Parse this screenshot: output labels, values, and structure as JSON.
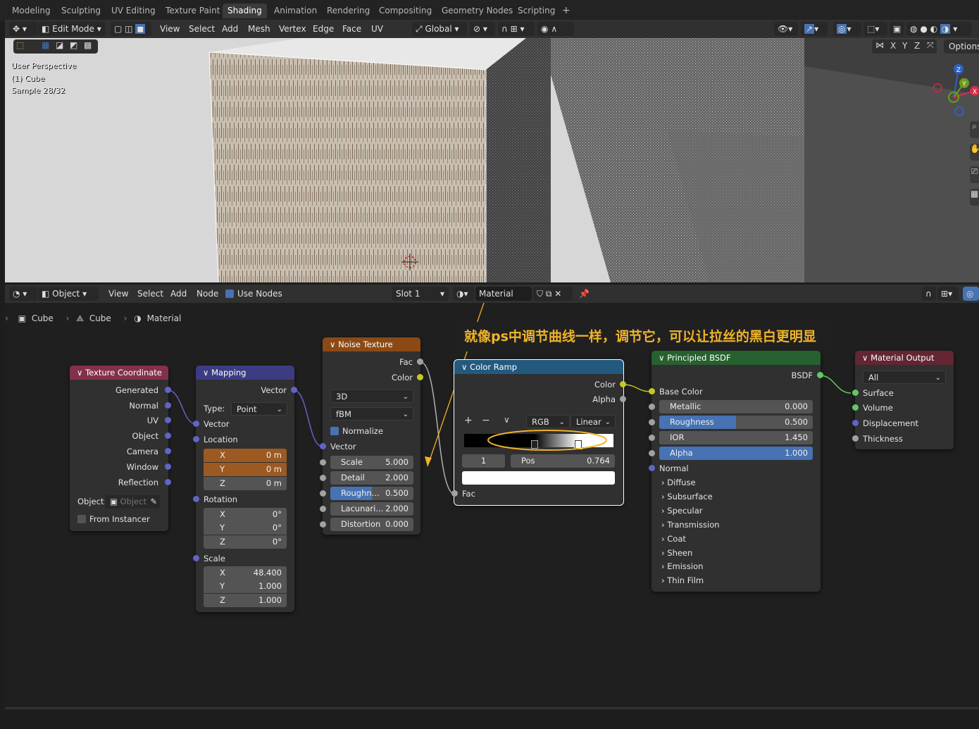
{
  "workspace_tabs": [
    "Modeling",
    "Sculpting",
    "UV Editing",
    "Texture Paint",
    "Shading",
    "Animation",
    "Rendering",
    "Compositing",
    "Geometry Nodes",
    "Scripting",
    "+"
  ],
  "viewport_header": {
    "mode": "Edit Mode",
    "menus": [
      "View",
      "Select",
      "Add",
      "Mesh",
      "Vertex",
      "Edge",
      "Face",
      "UV"
    ],
    "orientation": "Global",
    "options": "Options",
    "axes": [
      "X",
      "Y",
      "Z"
    ]
  },
  "viewport": {
    "overlay": [
      "User Perspective",
      "(1) Cube",
      "Sample 28/32"
    ],
    "gizmo": {
      "z": "Z",
      "y": "Y",
      "x": "X"
    }
  },
  "node_header": {
    "object_mode": "Object",
    "menus": [
      "View",
      "Select",
      "Add",
      "Node"
    ],
    "use_nodes": "Use Nodes",
    "slot": "Slot 1",
    "material": "Material"
  },
  "breadcrumb": [
    "Cube",
    "Cube",
    "Material"
  ],
  "annotation": "就像ps中调节曲线一样，调节它，可以让拉丝的黑白更明显",
  "nodes": {
    "texture_coordinate": {
      "title": "Texture Coordinate",
      "outputs": [
        "Generated",
        "Normal",
        "UV",
        "Object",
        "Camera",
        "Window",
        "Reflection"
      ],
      "object_label": "Object:",
      "object_placeholder": "Object",
      "from_instancer": "From Instancer"
    },
    "mapping": {
      "title": "Mapping",
      "output": "Vector",
      "type_label": "Type:",
      "type_value": "Point",
      "vector": "Vector",
      "location": "Location",
      "loc": [
        {
          "a": "X",
          "v": "0 m"
        },
        {
          "a": "Y",
          "v": "0 m"
        },
        {
          "a": "Z",
          "v": "0 m"
        }
      ],
      "rotation": "Rotation",
      "rot": [
        {
          "a": "X",
          "v": "0°"
        },
        {
          "a": "Y",
          "v": "0°"
        },
        {
          "a": "Z",
          "v": "0°"
        }
      ],
      "scale": "Scale",
      "scl": [
        {
          "a": "X",
          "v": "48.400"
        },
        {
          "a": "Y",
          "v": "1.000"
        },
        {
          "a": "Z",
          "v": "1.000"
        }
      ]
    },
    "noise": {
      "title": "Noise Texture",
      "outputs": [
        "Fac",
        "Color"
      ],
      "dim": "3D",
      "type": "fBM",
      "normalize": "Normalize",
      "vector": "Vector",
      "fields": [
        {
          "l": "Scale",
          "v": "5.000"
        },
        {
          "l": "Detail",
          "v": "2.000"
        },
        {
          "l": "Roughn...",
          "v": "0.500",
          "fill": 0.5
        },
        {
          "l": "Lacunari...",
          "v": "2.000"
        },
        {
          "l": "Distortion",
          "v": "0.000"
        }
      ]
    },
    "color_ramp": {
      "title": "Color Ramp",
      "outputs": [
        "Color",
        "Alpha"
      ],
      "mode": "RGB",
      "interp": "Linear",
      "plus": "+",
      "minus": "−",
      "index": "1",
      "pos_label": "Pos",
      "pos_value": "0.764",
      "input": "Fac",
      "stops": [
        0.47,
        0.764
      ]
    },
    "principled": {
      "title": "Principled BSDF",
      "output": "BSDF",
      "base_color": "Base Color",
      "fields": [
        {
          "l": "Metallic",
          "v": "0.000",
          "fill": 0
        },
        {
          "l": "Roughness",
          "v": "0.500",
          "fill": 0.5
        },
        {
          "l": "IOR",
          "v": "1.450",
          "fill": 0
        },
        {
          "l": "Alpha",
          "v": "1.000",
          "fill": 1
        }
      ],
      "normal": "Normal",
      "groups": [
        "Diffuse",
        "Subsurface",
        "Specular",
        "Transmission",
        "Coat",
        "Sheen",
        "Emission",
        "Thin Film"
      ]
    },
    "output": {
      "title": "Material Output",
      "target": "All",
      "inputs": [
        "Surface",
        "Volume",
        "Displacement",
        "Thickness"
      ]
    }
  },
  "colors": {
    "accent": "#4772b3",
    "texcoord_header": "#83314a",
    "mapping_header": "#3c3c83",
    "noise_header": "#8b4a15",
    "ramp_header": "#24597e",
    "bsdf_header": "#26612f",
    "output_header": "#632632",
    "vector_socket": "#6363c7",
    "float_socket": "#a1a1a1",
    "color_socket": "#c7c729",
    "shader_socket": "#63c763",
    "annotation": "#f0b428"
  }
}
